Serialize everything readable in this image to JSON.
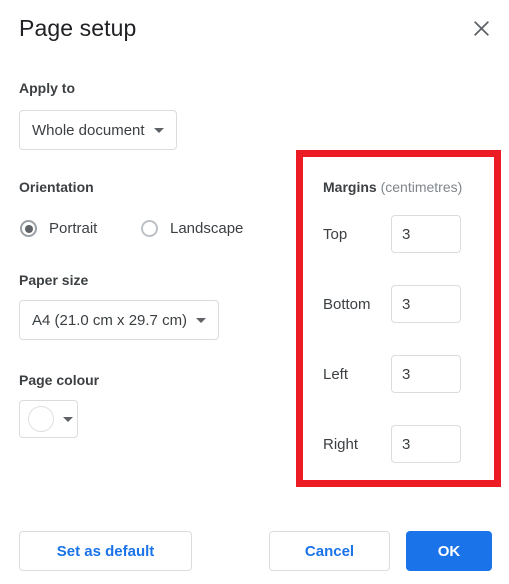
{
  "dialog": {
    "title": "Page setup",
    "close_icon": "close-icon"
  },
  "apply_to": {
    "label": "Apply to",
    "selected": "Whole document"
  },
  "orientation": {
    "label": "Orientation",
    "options": [
      {
        "label": "Portrait",
        "selected": true
      },
      {
        "label": "Landscape",
        "selected": false
      }
    ]
  },
  "paper_size": {
    "label": "Paper size",
    "selected": "A4 (21.0 cm x 29.7 cm)"
  },
  "page_colour": {
    "label": "Page colour",
    "swatch_colour": "#ffffff"
  },
  "margins": {
    "heading": "Margins",
    "unit": "(centimetres)",
    "fields": [
      {
        "label": "Top",
        "value": "3"
      },
      {
        "label": "Bottom",
        "value": "3"
      },
      {
        "label": "Left",
        "value": "3"
      },
      {
        "label": "Right",
        "value": "3"
      }
    ],
    "highlight_colour": "#ed1c24"
  },
  "footer": {
    "set_as_default": "Set as default",
    "cancel": "Cancel",
    "ok": "OK"
  },
  "colours": {
    "accent_blue": "#1a73e8",
    "text_primary": "#202124",
    "text_secondary": "#3c4043",
    "text_muted": "#80868b",
    "border": "#dadce0",
    "highlight_red": "#ed1c24"
  }
}
